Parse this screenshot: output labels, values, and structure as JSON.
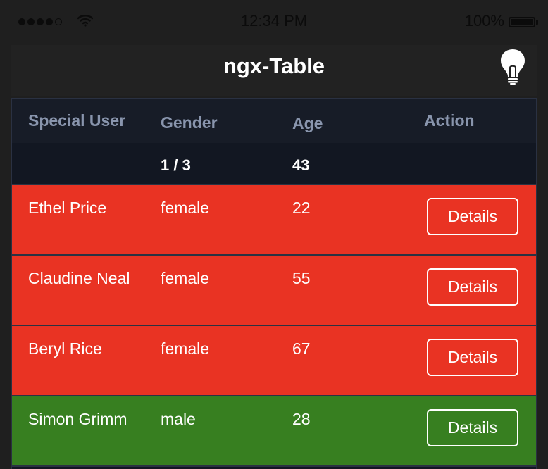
{
  "status_bar": {
    "time": "12:34 PM",
    "battery": "100%",
    "signal_icon": "signal-dots-icon",
    "wifi_icon": "wifi-icon",
    "battery_icon": "battery-icon"
  },
  "navbar": {
    "title": "ngx-Table",
    "bulb_icon": "lightbulb-icon"
  },
  "table": {
    "columns": [
      "Special User",
      "Gender",
      "Age",
      "Action"
    ],
    "filter": {
      "gender": "1 / 3",
      "age": "43"
    },
    "rows": [
      {
        "name": "Ethel Price",
        "gender": "female",
        "age": "22",
        "action": "Details",
        "color": "#e93323"
      },
      {
        "name": "Claudine Neal",
        "gender": "female",
        "age": "55",
        "action": "Details",
        "color": "#e93323"
      },
      {
        "name": "Beryl Rice",
        "gender": "female",
        "age": "67",
        "action": "Details",
        "color": "#e93323"
      },
      {
        "name": "Simon Grimm",
        "gender": "male",
        "age": "28",
        "action": "Details",
        "color": "#377f20"
      }
    ]
  },
  "colors": {
    "background": "#1f1f1f",
    "navbar": "#222222",
    "table_header": "#171c27",
    "row_red": "#e93323",
    "row_green": "#377f20"
  }
}
